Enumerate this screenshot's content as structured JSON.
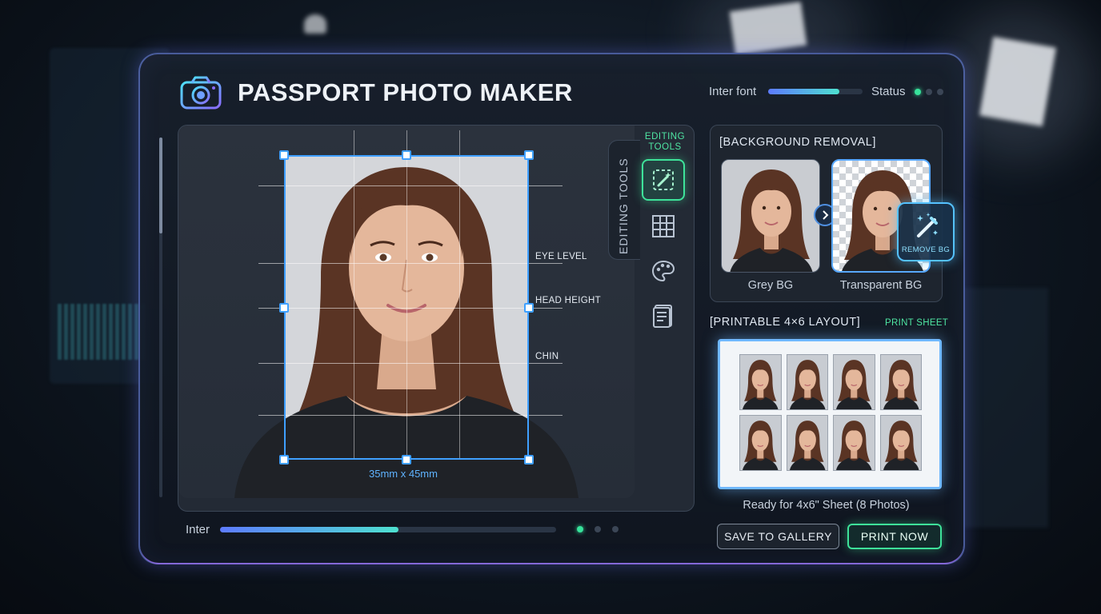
{
  "app": {
    "title": "PASSPORT PHOTO MAKER"
  },
  "header": {
    "font_label": "Inter font",
    "font_slider_level": 0.75,
    "status_label": "Status",
    "status_dots": [
      "on",
      "off",
      "off"
    ]
  },
  "editor": {
    "guides": {
      "eye_level": "EYE LEVEL",
      "head_height": "HEAD HEIGHT",
      "chin": "CHIN"
    },
    "dimensions": "35mm x 45mm",
    "tools_tab_label": "EDITING TOOLS",
    "tools_title": "EDITING\nTOOLS",
    "tools": [
      {
        "icon": "magic-crop-icon",
        "active": true
      },
      {
        "icon": "grid-icon",
        "active": false
      },
      {
        "icon": "palette-icon",
        "active": false
      },
      {
        "icon": "document-icon",
        "active": false
      }
    ]
  },
  "bottom_bar": {
    "label": "Inter",
    "progress": 0.53,
    "page_dots": [
      "on",
      "off",
      "off"
    ]
  },
  "background_removal": {
    "title": "[BACKGROUND REMOVAL]",
    "before_label": "Grey BG",
    "after_label": "Transparent BG",
    "remove_button": "REMOVE BG"
  },
  "print_layout": {
    "title": "[PRINTABLE 4×6 LAYOUT]",
    "print_sheet_link": "PRINT SHEET",
    "photo_count": 8,
    "caption": "Ready for 4x6\" Sheet (8 Photos)"
  },
  "actions": {
    "save_label": "SAVE TO GALLERY",
    "print_label": "PRINT NOW"
  },
  "colors": {
    "accent_green": "#3ee39a",
    "accent_blue": "#3fa0ff",
    "window_border": "#7896ff"
  }
}
